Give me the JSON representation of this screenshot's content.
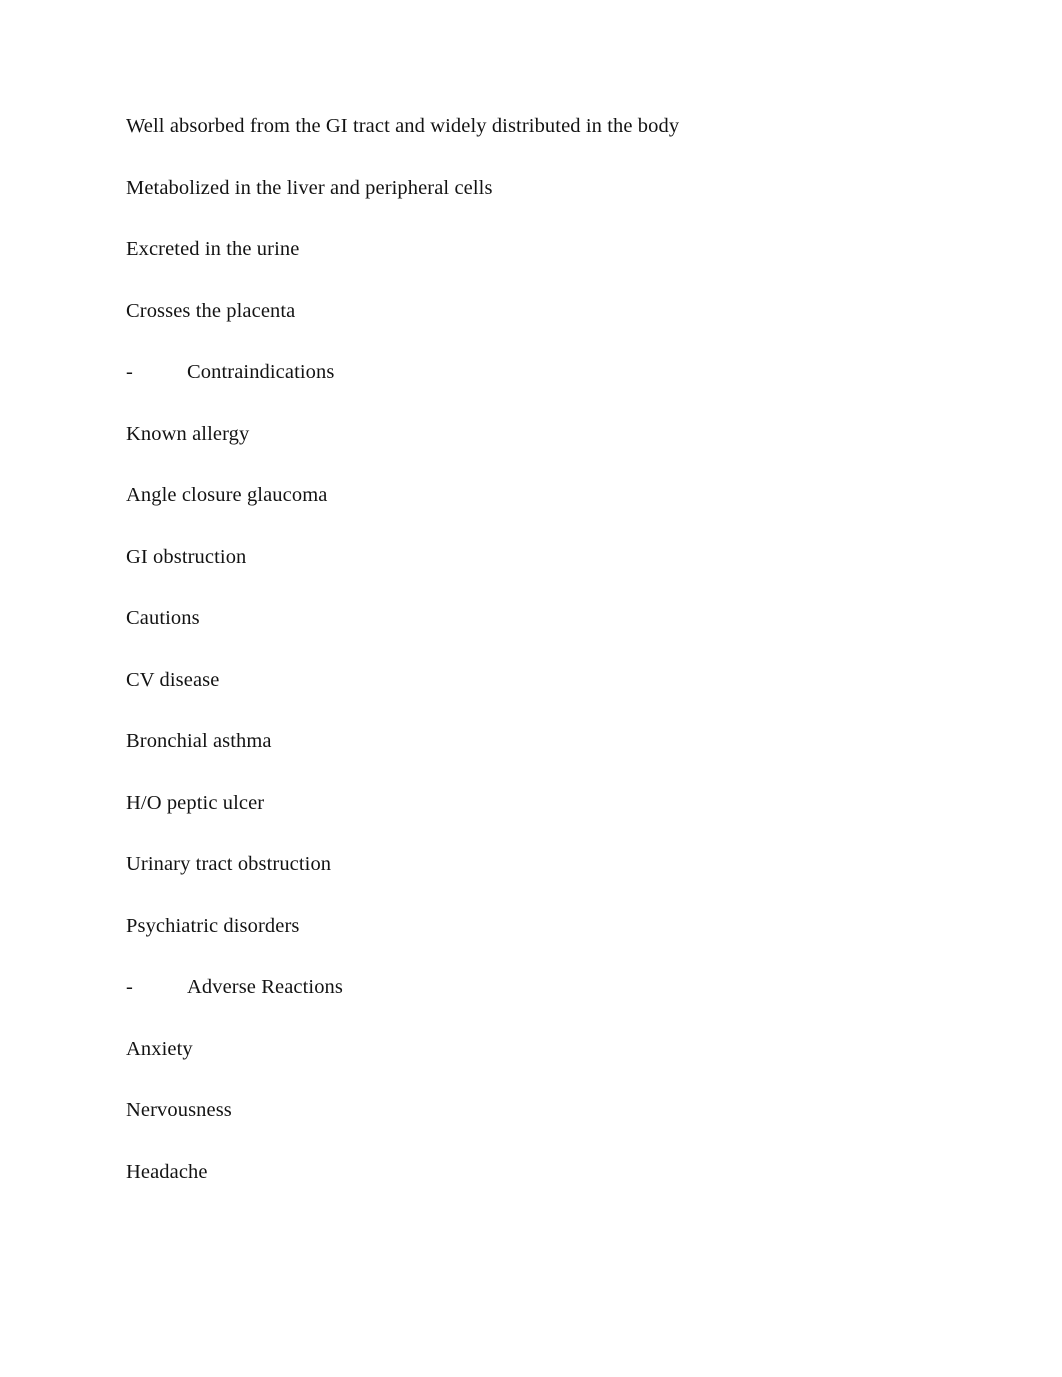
{
  "document": {
    "background_color": "#ffffff",
    "text_color": "#131313",
    "paragraphs": [
      {
        "id": "p1",
        "type": "text",
        "text": "Well absorbed from the GI tract and widely distributed in the body"
      },
      {
        "id": "p2",
        "type": "text",
        "text": "Metabolized in the liver and peripheral cells"
      },
      {
        "id": "p3",
        "type": "text",
        "text": "Excreted in the urine"
      },
      {
        "id": "p4",
        "type": "text",
        "text": "Crosses the placenta"
      },
      {
        "id": "p5",
        "type": "heading",
        "marker": "-",
        "text": "Contraindications"
      },
      {
        "id": "p6",
        "type": "text",
        "text": "Known allergy"
      },
      {
        "id": "p7",
        "type": "text",
        "text": "Angle closure glaucoma"
      },
      {
        "id": "p8",
        "type": "text",
        "text": "GI obstruction"
      },
      {
        "id": "p9",
        "type": "text",
        "text": "Cautions"
      },
      {
        "id": "p10",
        "type": "text",
        "text": "CV disease"
      },
      {
        "id": "p11",
        "type": "text",
        "text": "Bronchial asthma"
      },
      {
        "id": "p12",
        "type": "text",
        "text": "H/O peptic ulcer"
      },
      {
        "id": "p13",
        "type": "text",
        "text": "Urinary tract obstruction"
      },
      {
        "id": "p14",
        "type": "text",
        "text": "Psychiatric disorders"
      },
      {
        "id": "p15",
        "type": "heading",
        "marker": "-",
        "text": "Adverse Reactions"
      },
      {
        "id": "p16",
        "type": "text",
        "text": "Anxiety"
      },
      {
        "id": "p17",
        "type": "text",
        "text": "Nervousness"
      },
      {
        "id": "p18",
        "type": "text",
        "text": "Headache"
      }
    ]
  }
}
